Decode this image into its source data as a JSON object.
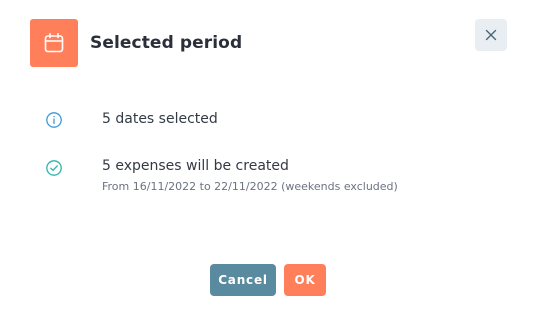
{
  "dialog": {
    "title": "Selected period",
    "header_icon": "calendar-icon",
    "close_icon": "close-icon"
  },
  "info_row": {
    "icon": "info-icon",
    "text": "5 dates selected"
  },
  "success_row": {
    "icon": "check-circle-icon",
    "text": "5 expenses will be created",
    "subtext": "From 16/11/2022 to 22/11/2022 (weekends excluded)"
  },
  "buttons": {
    "cancel_label": "Cancel",
    "ok_label": "OK"
  },
  "colors": {
    "accent": "#ff7f5a",
    "cancel": "#5a8a9f",
    "info": "#3a9ad9",
    "success": "#2bb5a8"
  }
}
